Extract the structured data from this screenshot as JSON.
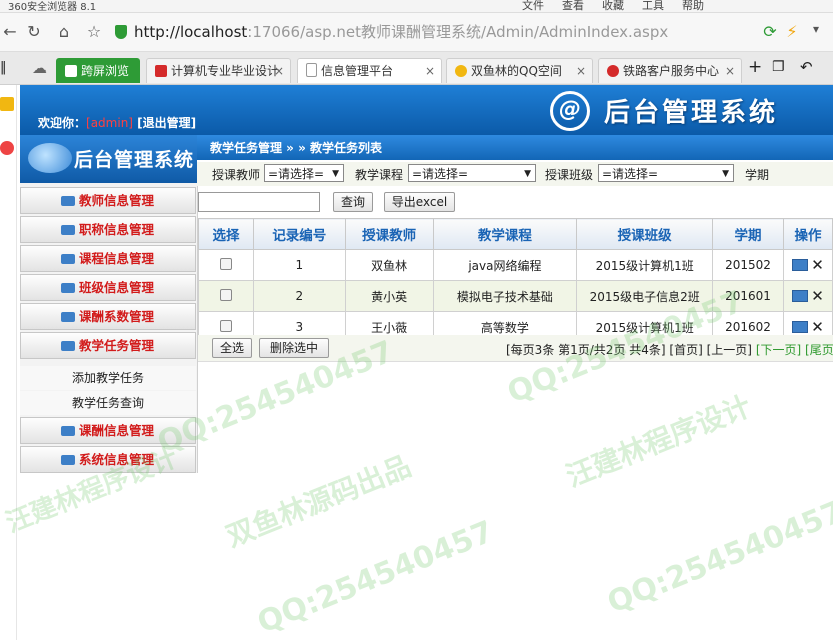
{
  "browser": {
    "app_title": "360安全浏览器 8.1",
    "menu": [
      "文件",
      "查看",
      "收藏",
      "工具",
      "帮助"
    ],
    "url_host": "http://localhost",
    "url_path": ":17066/asp.net教师课酬管理系统/Admin/AdminIndex.aspx",
    "tabs": [
      {
        "label": "跨屏浏览",
        "color": "#2e9b36"
      },
      {
        "label": "计算机专业毕业设计",
        "color": "#d42a2a"
      },
      {
        "label": "信息管理平台",
        "color": "#9a9a9a"
      },
      {
        "label": "双鱼林的QQ空间",
        "color": "#f1b711"
      },
      {
        "label": "铁路客户服务中心",
        "color": "#d42a2a"
      }
    ]
  },
  "header": {
    "welcome_label": "欢迎你：",
    "username": "[admin]",
    "logout_label": "[退出管理]",
    "logo_letter": "@",
    "system_title": "后台管理系统"
  },
  "sidebar": {
    "title": "后台管理系统",
    "items": [
      {
        "label": "教师信息管理"
      },
      {
        "label": "职称信息管理"
      },
      {
        "label": "课程信息管理"
      },
      {
        "label": "班级信息管理"
      },
      {
        "label": "课酬系数管理"
      },
      {
        "label": "教学任务管理"
      }
    ],
    "subitems": [
      "添加教学任务",
      "教学任务查询"
    ],
    "items_after": [
      {
        "label": "课酬信息管理"
      },
      {
        "label": "系统信息管理"
      }
    ]
  },
  "main": {
    "breadcrumb": "教学任务管理 » » 教学任务列表",
    "filters": {
      "teacher_label": "授课教师",
      "teacher_value": "=请选择=",
      "course_label": "教学课程",
      "course_value": "=请选择=",
      "class_label": "授课班级",
      "class_value": "=请选择=",
      "term_label": "学期"
    },
    "search_button": "查询",
    "export_button": "导出excel",
    "table": {
      "columns": [
        "选择",
        "记录编号",
        "授课教师",
        "教学课程",
        "授课班级",
        "学期",
        "操作"
      ],
      "rows": [
        {
          "id": "1",
          "teacher": "双鱼林",
          "course": "java网络编程",
          "class": "2015级计算机1班",
          "term": "201502"
        },
        {
          "id": "2",
          "teacher": "黄小英",
          "course": "模拟电子技术基础",
          "class": "2015级电子信息2班",
          "term": "201601"
        },
        {
          "id": "3",
          "teacher": "王小薇",
          "course": "高等数学",
          "class": "2015级计算机1班",
          "term": "201602"
        }
      ]
    },
    "select_all_button": "全选",
    "delete_selected_button": "删除选中",
    "pager": {
      "summary": "[每页3条 第1页/共2页 共4条]",
      "first": "[首页]",
      "prev": "[上一页]",
      "next": "[下一页]",
      "last": "[尾页]"
    }
  },
  "watermarks": {
    "qq": "QQ:254540457",
    "brand": "双鱼林源码出品",
    "author": "汪建林程序设计"
  }
}
